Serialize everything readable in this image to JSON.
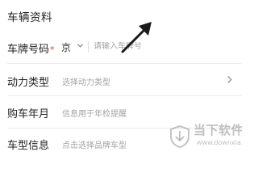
{
  "section": {
    "title": "车辆资料"
  },
  "fields": {
    "plate": {
      "label": "车牌号码",
      "required_mark": "*",
      "province": "京",
      "placeholder": "请输入车牌号"
    },
    "power": {
      "label": "动力类型",
      "placeholder": "选择动力类型"
    },
    "purchase": {
      "label": "购车年月",
      "placeholder": "信息用于年检提醒"
    },
    "model": {
      "label": "车型信息",
      "placeholder": "点击选择品牌车型"
    }
  },
  "watermark": {
    "title": "当下软件园",
    "subtitle": "www.downxia.com",
    "logo_icon": "download-shield-icon"
  },
  "annotation": {
    "arrow_icon": "pointer-arrow-icon",
    "arrow_color": "#1a1a1a"
  },
  "colors": {
    "label": "#222222",
    "placeholder": "#a3a3a3",
    "required": "#e53935",
    "divider": "#ebebeb"
  }
}
